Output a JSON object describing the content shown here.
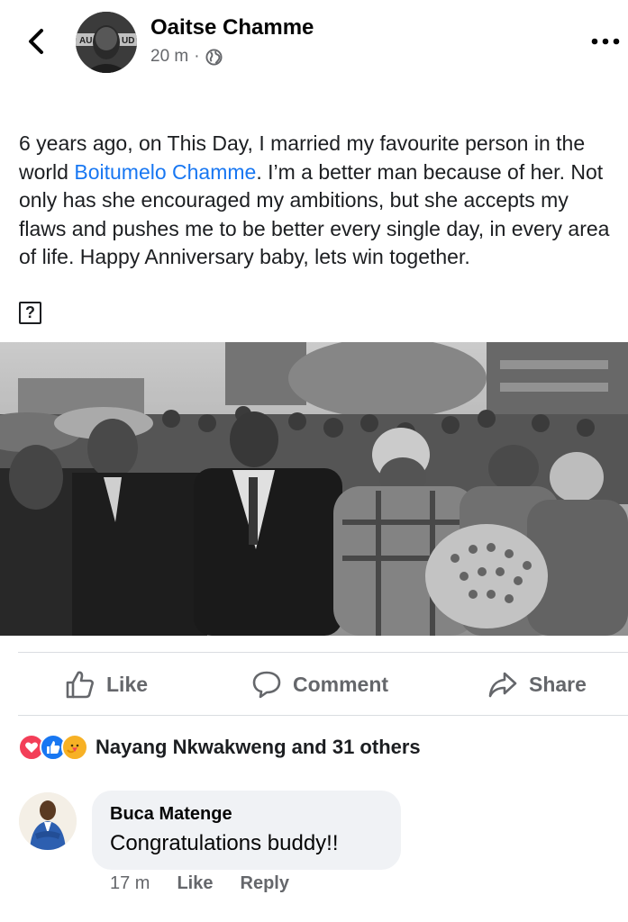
{
  "header": {
    "author": "Oaitse Chamme",
    "time": "20 m",
    "separator": "·",
    "privacy_icon": "globe-icon",
    "avatar_caption_left": "AU",
    "avatar_caption_right": "UD"
  },
  "post": {
    "text_before": "6 years ago, on This Day, I married my favourite person in the world ",
    "mention": "Boitumelo Chamme",
    "text_after": ". I’m a better man because of her. Not only has she encouraged my ambitions, but she accepts my flaws and pushes me to be better every single day, in every area of life. Happy Anniversary baby, lets win together.",
    "unknown_glyph": "?"
  },
  "actions": {
    "like": "Like",
    "comment": "Comment",
    "share": "Share"
  },
  "reactions": {
    "types": [
      "love",
      "like",
      "care"
    ],
    "summary": "Nayang Nkwakweng and 31 others"
  },
  "comment": {
    "name": "Buca Matenge",
    "text": "Congratulations buddy!!",
    "time": "17 m",
    "like": "Like",
    "reply": "Reply"
  },
  "colors": {
    "link": "#1877f2",
    "secondary_text": "#65676b",
    "bubble": "#f0f2f5",
    "love": "#f33e58",
    "like": "#1877f2",
    "care": "#f7b125"
  }
}
